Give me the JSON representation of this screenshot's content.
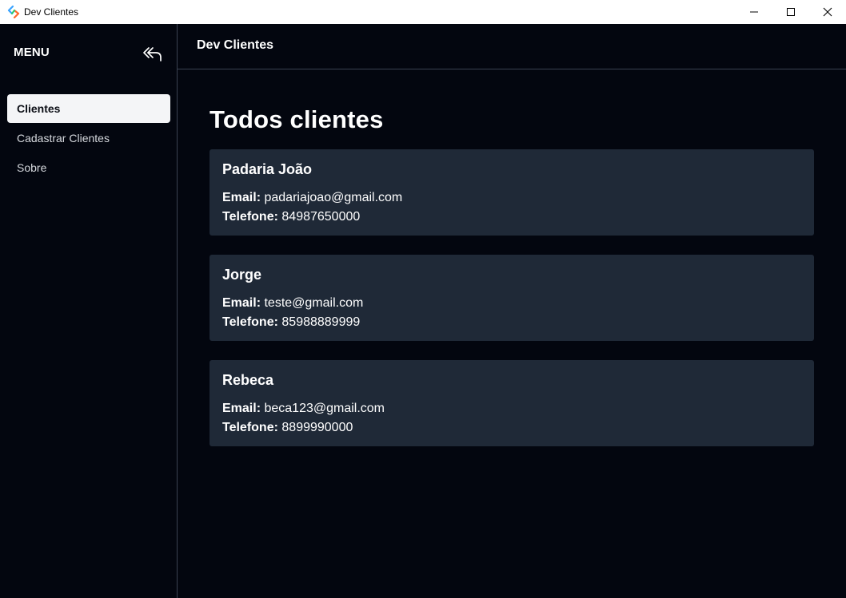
{
  "window": {
    "title": "Dev Clientes"
  },
  "sidebar": {
    "menu_title": "MENU",
    "items": [
      {
        "label": "Clientes",
        "active": true
      },
      {
        "label": "Cadastrar Clientes",
        "active": false
      },
      {
        "label": "Sobre",
        "active": false
      }
    ]
  },
  "header": {
    "title": "Dev Clientes"
  },
  "main": {
    "title": "Todos clientes",
    "email_label": "Email:",
    "phone_label": "Telefone:",
    "clients": [
      {
        "name": "Padaria João",
        "email": "padariajoao@gmail.com",
        "phone": "84987650000"
      },
      {
        "name": "Jorge",
        "email": "teste@gmail.com",
        "phone": "85988889999"
      },
      {
        "name": "Rebeca",
        "email": "beca123@gmail.com",
        "phone": "8899990000"
      }
    ]
  },
  "colors": {
    "background": "#03060f",
    "card": "#1f2937",
    "active_item": "#f4f5f7",
    "border": "#3a4252"
  },
  "icons": {
    "collapse": "double-arrow-back-icon",
    "minimize": "minimize-icon",
    "maximize": "maximize-icon",
    "close": "close-icon"
  }
}
